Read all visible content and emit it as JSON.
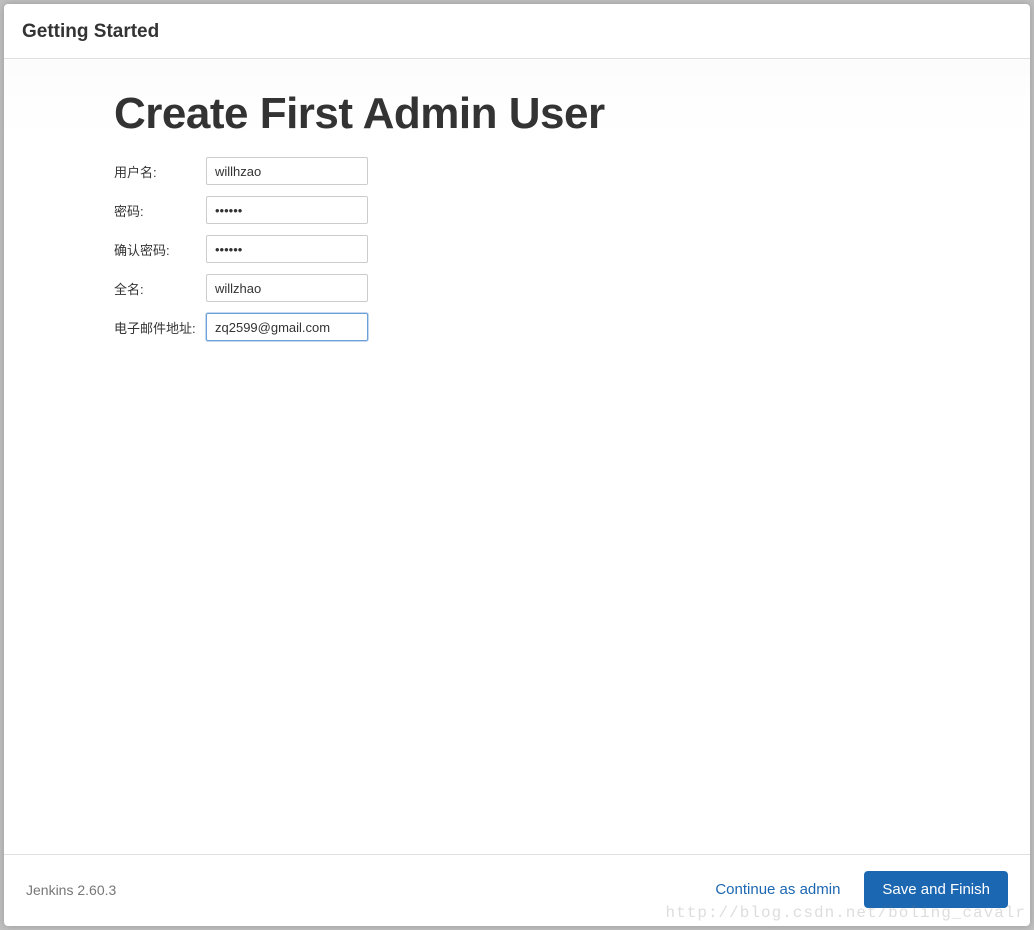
{
  "header": {
    "title": "Getting Started"
  },
  "main": {
    "title": "Create First Admin User"
  },
  "form": {
    "username": {
      "label": "用户名:",
      "value": "willhzao"
    },
    "password": {
      "label": "密码:",
      "value": "••••••"
    },
    "confirm": {
      "label": "确认密码:",
      "value": "••••••"
    },
    "fullname": {
      "label": "全名:",
      "value": "willzhao"
    },
    "email": {
      "label": "电子邮件地址:",
      "value": "zq2599@gmail.com"
    }
  },
  "footer": {
    "version": "Jenkins 2.60.3",
    "continue_label": "Continue as admin",
    "save_label": "Save and Finish"
  },
  "watermark": "http://blog.csdn.net/boling_cavalr"
}
